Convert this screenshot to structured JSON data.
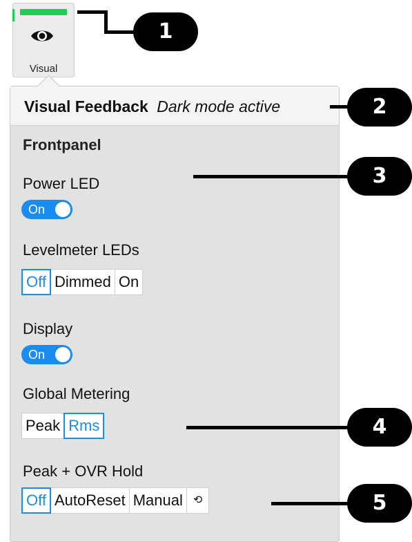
{
  "tab": {
    "label": "Visual",
    "icon": "eye-icon",
    "indicator_color": "#22cc55"
  },
  "callouts": [
    "1",
    "2",
    "3",
    "4",
    "5"
  ],
  "panel": {
    "title": "Visual Feedback",
    "subtitle": "Dark mode active",
    "section": "Frontpanel",
    "power_led": {
      "label": "Power LED",
      "toggle": "On"
    },
    "levelmeter": {
      "label": "Levelmeter LEDs",
      "options": [
        "Off",
        "Dimmed",
        "On"
      ],
      "selected": "Off"
    },
    "display": {
      "label": "Display",
      "toggle": "On"
    },
    "global_metering": {
      "label": "Global Metering",
      "options": [
        "Peak",
        "Rms"
      ],
      "selected": "Rms"
    },
    "peak_hold": {
      "label": "Peak + OVR Hold",
      "options": [
        "Off",
        "AutoReset",
        "Manual"
      ],
      "selected": "Off",
      "reset_icon": "⟲"
    }
  },
  "colors": {
    "accent": "#1a8cf0",
    "panel_bg": "#e2e2e2",
    "indicator": "#22cc55"
  }
}
